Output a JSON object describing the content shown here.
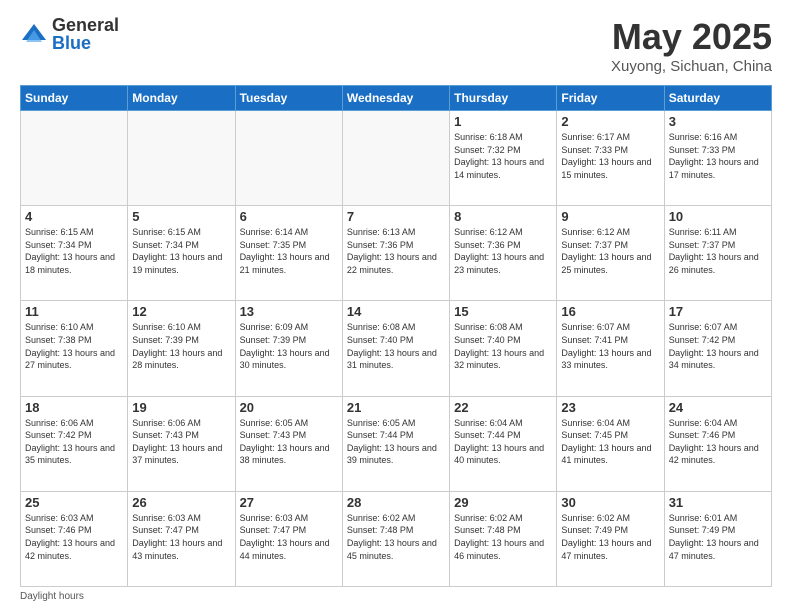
{
  "logo": {
    "general": "General",
    "blue": "Blue"
  },
  "header": {
    "title": "May 2025",
    "subtitle": "Xuyong, Sichuan, China"
  },
  "days_of_week": [
    "Sunday",
    "Monday",
    "Tuesday",
    "Wednesday",
    "Thursday",
    "Friday",
    "Saturday"
  ],
  "weeks": [
    [
      {
        "day": "",
        "info": ""
      },
      {
        "day": "",
        "info": ""
      },
      {
        "day": "",
        "info": ""
      },
      {
        "day": "",
        "info": ""
      },
      {
        "day": "1",
        "info": "Sunrise: 6:18 AM\nSunset: 7:32 PM\nDaylight: 13 hours and 14 minutes."
      },
      {
        "day": "2",
        "info": "Sunrise: 6:17 AM\nSunset: 7:33 PM\nDaylight: 13 hours and 15 minutes."
      },
      {
        "day": "3",
        "info": "Sunrise: 6:16 AM\nSunset: 7:33 PM\nDaylight: 13 hours and 17 minutes."
      }
    ],
    [
      {
        "day": "4",
        "info": "Sunrise: 6:15 AM\nSunset: 7:34 PM\nDaylight: 13 hours and 18 minutes."
      },
      {
        "day": "5",
        "info": "Sunrise: 6:15 AM\nSunset: 7:34 PM\nDaylight: 13 hours and 19 minutes."
      },
      {
        "day": "6",
        "info": "Sunrise: 6:14 AM\nSunset: 7:35 PM\nDaylight: 13 hours and 21 minutes."
      },
      {
        "day": "7",
        "info": "Sunrise: 6:13 AM\nSunset: 7:36 PM\nDaylight: 13 hours and 22 minutes."
      },
      {
        "day": "8",
        "info": "Sunrise: 6:12 AM\nSunset: 7:36 PM\nDaylight: 13 hours and 23 minutes."
      },
      {
        "day": "9",
        "info": "Sunrise: 6:12 AM\nSunset: 7:37 PM\nDaylight: 13 hours and 25 minutes."
      },
      {
        "day": "10",
        "info": "Sunrise: 6:11 AM\nSunset: 7:37 PM\nDaylight: 13 hours and 26 minutes."
      }
    ],
    [
      {
        "day": "11",
        "info": "Sunrise: 6:10 AM\nSunset: 7:38 PM\nDaylight: 13 hours and 27 minutes."
      },
      {
        "day": "12",
        "info": "Sunrise: 6:10 AM\nSunset: 7:39 PM\nDaylight: 13 hours and 28 minutes."
      },
      {
        "day": "13",
        "info": "Sunrise: 6:09 AM\nSunset: 7:39 PM\nDaylight: 13 hours and 30 minutes."
      },
      {
        "day": "14",
        "info": "Sunrise: 6:08 AM\nSunset: 7:40 PM\nDaylight: 13 hours and 31 minutes."
      },
      {
        "day": "15",
        "info": "Sunrise: 6:08 AM\nSunset: 7:40 PM\nDaylight: 13 hours and 32 minutes."
      },
      {
        "day": "16",
        "info": "Sunrise: 6:07 AM\nSunset: 7:41 PM\nDaylight: 13 hours and 33 minutes."
      },
      {
        "day": "17",
        "info": "Sunrise: 6:07 AM\nSunset: 7:42 PM\nDaylight: 13 hours and 34 minutes."
      }
    ],
    [
      {
        "day": "18",
        "info": "Sunrise: 6:06 AM\nSunset: 7:42 PM\nDaylight: 13 hours and 35 minutes."
      },
      {
        "day": "19",
        "info": "Sunrise: 6:06 AM\nSunset: 7:43 PM\nDaylight: 13 hours and 37 minutes."
      },
      {
        "day": "20",
        "info": "Sunrise: 6:05 AM\nSunset: 7:43 PM\nDaylight: 13 hours and 38 minutes."
      },
      {
        "day": "21",
        "info": "Sunrise: 6:05 AM\nSunset: 7:44 PM\nDaylight: 13 hours and 39 minutes."
      },
      {
        "day": "22",
        "info": "Sunrise: 6:04 AM\nSunset: 7:44 PM\nDaylight: 13 hours and 40 minutes."
      },
      {
        "day": "23",
        "info": "Sunrise: 6:04 AM\nSunset: 7:45 PM\nDaylight: 13 hours and 41 minutes."
      },
      {
        "day": "24",
        "info": "Sunrise: 6:04 AM\nSunset: 7:46 PM\nDaylight: 13 hours and 42 minutes."
      }
    ],
    [
      {
        "day": "25",
        "info": "Sunrise: 6:03 AM\nSunset: 7:46 PM\nDaylight: 13 hours and 42 minutes."
      },
      {
        "day": "26",
        "info": "Sunrise: 6:03 AM\nSunset: 7:47 PM\nDaylight: 13 hours and 43 minutes."
      },
      {
        "day": "27",
        "info": "Sunrise: 6:03 AM\nSunset: 7:47 PM\nDaylight: 13 hours and 44 minutes."
      },
      {
        "day": "28",
        "info": "Sunrise: 6:02 AM\nSunset: 7:48 PM\nDaylight: 13 hours and 45 minutes."
      },
      {
        "day": "29",
        "info": "Sunrise: 6:02 AM\nSunset: 7:48 PM\nDaylight: 13 hours and 46 minutes."
      },
      {
        "day": "30",
        "info": "Sunrise: 6:02 AM\nSunset: 7:49 PM\nDaylight: 13 hours and 47 minutes."
      },
      {
        "day": "31",
        "info": "Sunrise: 6:01 AM\nSunset: 7:49 PM\nDaylight: 13 hours and 47 minutes."
      }
    ]
  ],
  "footer": {
    "daylight_label": "Daylight hours"
  }
}
